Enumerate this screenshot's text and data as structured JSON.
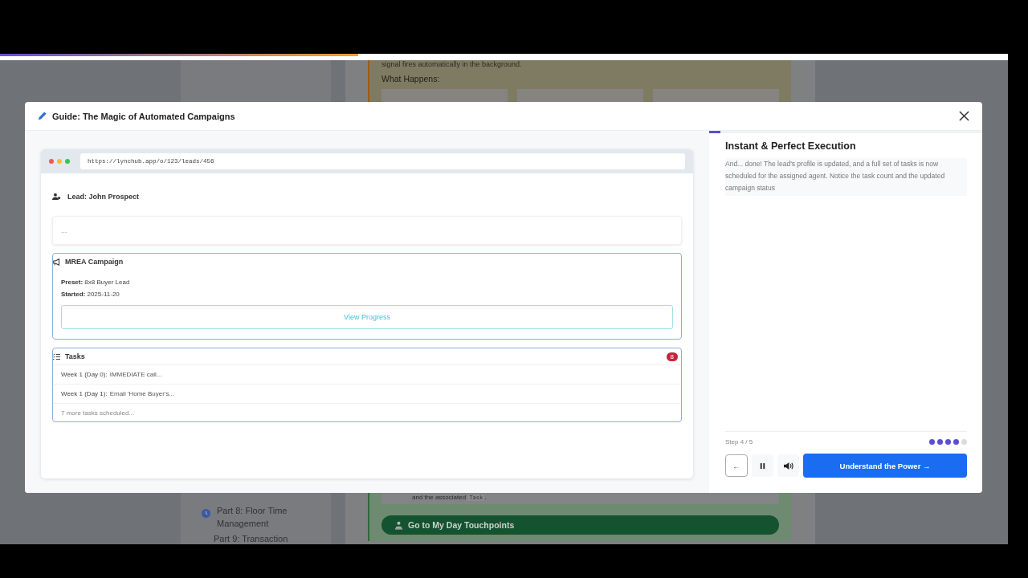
{
  "page_progress": {
    "level": 0.355
  },
  "background": {
    "sidebar_items": [
      {
        "label": "Part 8: Floor Time Management"
      },
      {
        "label": "Part 9: Transaction"
      }
    ],
    "top_text": "signal fires automatically in the background.",
    "what_happens": "What Happens:",
    "bottom_text": "and the associated",
    "bottom_code": "Task",
    "bottom_end": ".",
    "touchpoints_button": "Go to My Day Touchpoints"
  },
  "modal": {
    "title": "Guide: The Magic of Automated Campaigns",
    "browser": {
      "url": "https://lynchub.app/o/123/leads/456",
      "lead": "Lead: John Prospect",
      "placeholder_text": "...",
      "campaign": {
        "title": "MREA Campaign",
        "fields": [
          {
            "label": "Preset:",
            "value": "8x8 Buyer Lead"
          },
          {
            "label": "Started:",
            "value": "2025-11-20"
          }
        ],
        "button": "View Progress"
      },
      "tasks": {
        "title": "Tasks",
        "count": "8",
        "items": [
          {
            "label": "Week 1 (Day 0):",
            "text": "IMMEDIATE call..."
          },
          {
            "label": "Week 1 (Day 1):",
            "text": "Email 'Home Buyer's..."
          }
        ],
        "more": "7 more tasks scheduled..."
      }
    },
    "step": {
      "progress": {
        "level": 0.04
      },
      "title": "Instant & Perfect Execution",
      "description": "And... done! The lead's profile is updated, and a full set of tasks is now scheduled for the assigned agent. Notice the task count and the updated campaign status",
      "counter": "Step 4 / 5",
      "dots": [
        {
          "filled": true
        },
        {
          "filled": true
        },
        {
          "filled": true
        },
        {
          "filled": true
        },
        {
          "filled": false
        }
      ],
      "back_label": "←",
      "next_button": "Understand the Power →"
    }
  }
}
